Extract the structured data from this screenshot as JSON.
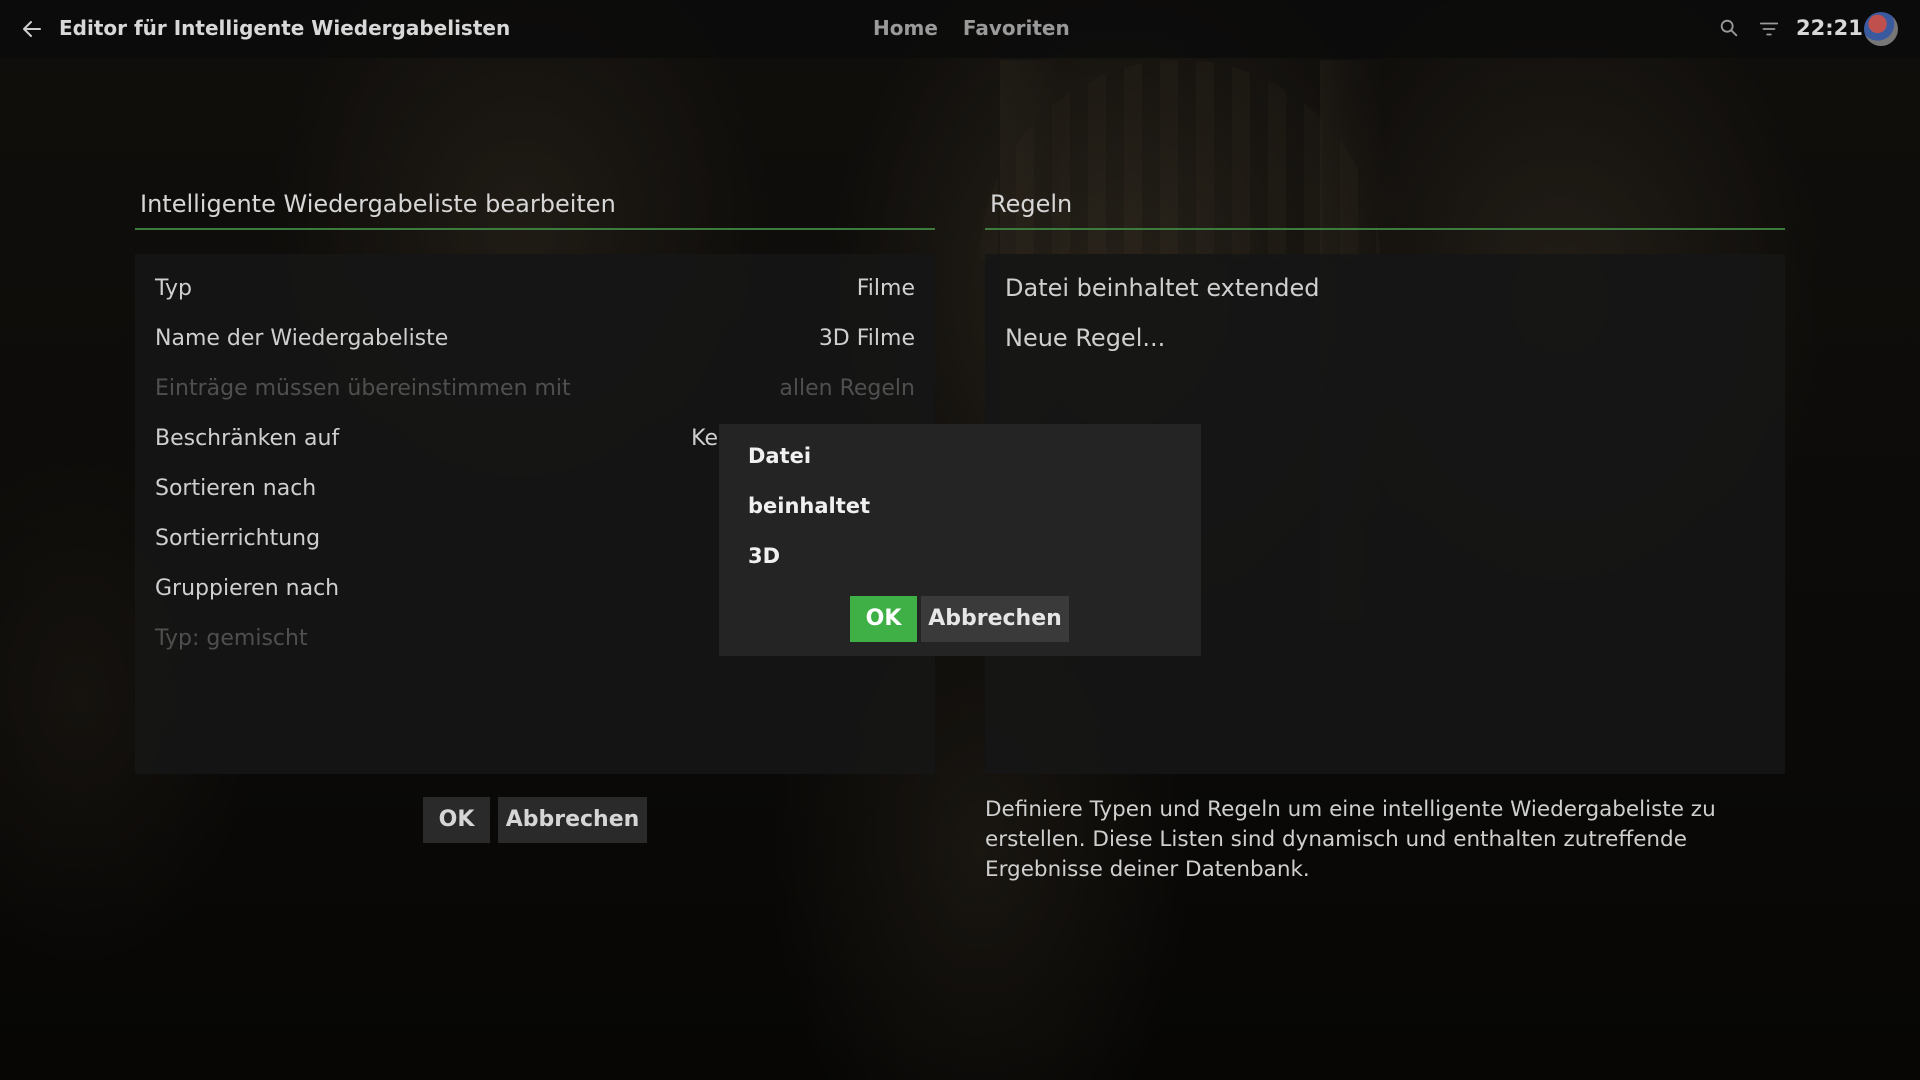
{
  "topbar": {
    "title": "Editor für Intelligente Wiedergabelisten",
    "nav": [
      "Home",
      "Favoriten"
    ],
    "time": "22:21"
  },
  "left_panel": {
    "header": "Intelligente Wiedergabeliste bearbeiten",
    "rows": [
      {
        "label": "Typ",
        "value": "Filme",
        "disabled": false
      },
      {
        "label": "Name der Wiedergabeliste",
        "value": "3D Filme",
        "disabled": false
      },
      {
        "label": "Einträge müssen übereinstimmen mit",
        "value": "allen Regeln",
        "disabled": true
      },
      {
        "label": "Beschränken auf",
        "value": "Ke",
        "disabled": false
      },
      {
        "label": "Sortieren nach",
        "value": "",
        "disabled": false
      },
      {
        "label": "Sortierrichtung",
        "value": "",
        "disabled": false
      },
      {
        "label": "Gruppieren nach",
        "value": "",
        "disabled": false
      },
      {
        "label": "Typ: gemischt",
        "value": "",
        "disabled": true
      }
    ],
    "ok_label": "OK",
    "cancel_label": "Abbrechen"
  },
  "right_panel": {
    "header": "Regeln",
    "rules": [
      "Datei beinhaltet extended",
      "Neue Regel..."
    ],
    "help_text": "Definiere Typen und Regeln um eine intelligente Wiedergabeliste zu erstellen. Diese Listen sind dynamisch und enthalten zutreffende Ergebnisse deiner Datenbank."
  },
  "dialog": {
    "field": "Datei",
    "operator": "beinhaltet",
    "value": "3D",
    "ok_label": "OK",
    "cancel_label": "Abbrechen"
  },
  "colors": {
    "accent": "#3fb046",
    "header_underline": "#3d7a3d"
  },
  "icons": {
    "back": "arrow-left-icon",
    "search": "search-icon",
    "filter": "filter-icon"
  }
}
